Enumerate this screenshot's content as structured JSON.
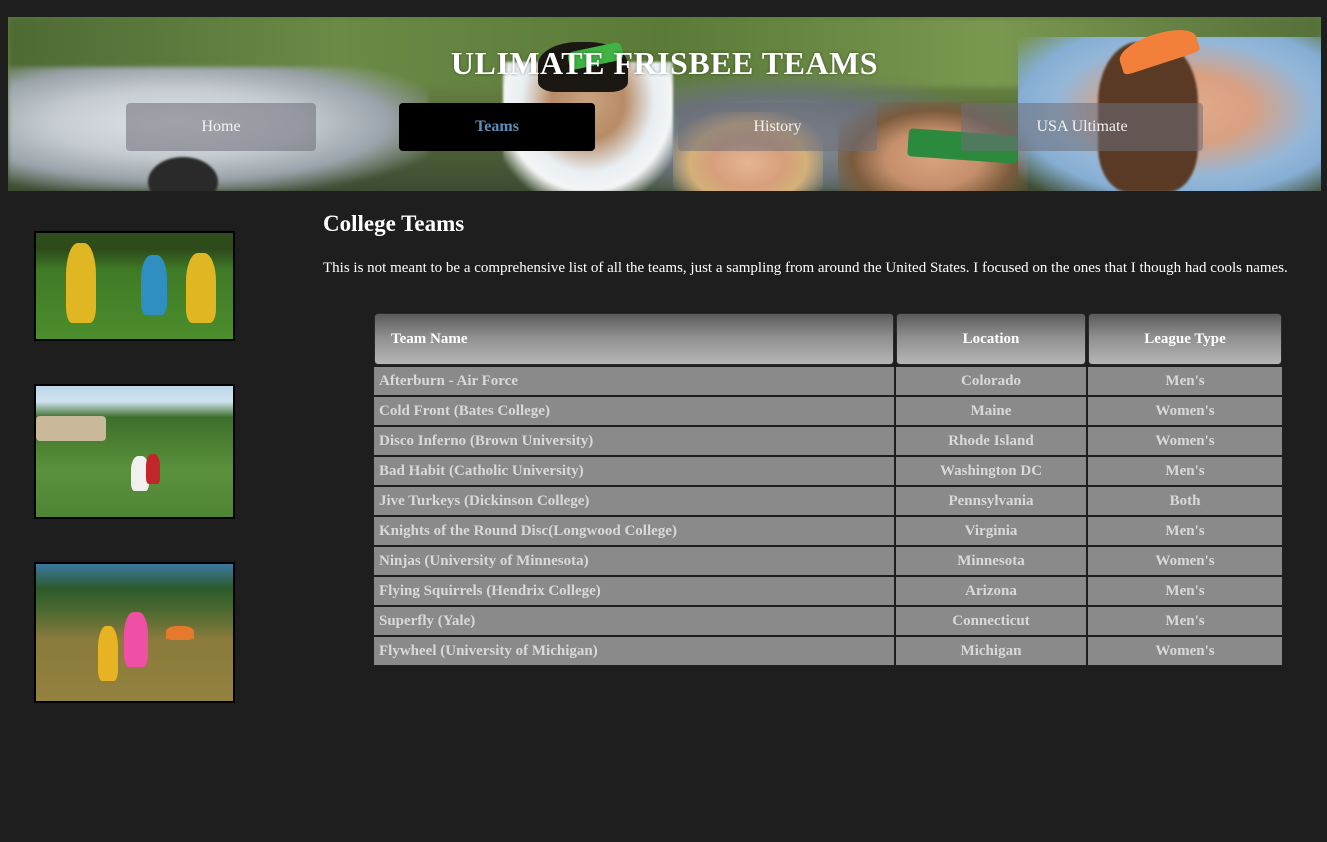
{
  "site": {
    "title": "ULIMATE FRISBEE TEAMS"
  },
  "nav": {
    "items": [
      {
        "label": "Home"
      },
      {
        "label": "Teams",
        "active": true
      },
      {
        "label": "History"
      },
      {
        "label": "USA Ultimate"
      }
    ]
  },
  "main": {
    "heading": "College Teams",
    "intro": "This is not meant to be a comprehensive list of all the teams, just a sampling from around the United States. I focused on the ones that I though had cools names."
  },
  "table": {
    "headers": {
      "team_name": "Team Name",
      "location": "Location",
      "league_type": "League Type"
    },
    "rows": [
      {
        "team": "Afterburn - Air Force",
        "location": "Colorado",
        "league": "Men's"
      },
      {
        "team": "Cold Front (Bates College)",
        "location": "Maine",
        "league": "Women's"
      },
      {
        "team": "Disco Inferno (Brown University)",
        "location": "Rhode Island",
        "league": "Women's"
      },
      {
        "team": "Bad Habit (Catholic University)",
        "location": "Washington DC",
        "league": "Men's"
      },
      {
        "team": "Jive Turkeys (Dickinson College)",
        "location": "Pennsylvania",
        "league": "Both"
      },
      {
        "team": "Knights of the Round Disc(Longwood College)",
        "location": "Virginia",
        "league": "Men's"
      },
      {
        "team": "Ninjas (University of Minnesota)",
        "location": "Minnesota",
        "league": "Women's"
      },
      {
        "team": "Flying Squirrels (Hendrix College)",
        "location": "Arizona",
        "league": "Men's"
      },
      {
        "team": "Superfly (Yale)",
        "location": "Connecticut",
        "league": "Men's"
      },
      {
        "team": "Flywheel (University of Michigan)",
        "location": "Michigan",
        "league": "Women's"
      }
    ]
  },
  "colors": {
    "page_background": "#1e1e1e",
    "active_nav_text": "#5b8fb9",
    "table_cell": "#8a8a8a"
  }
}
